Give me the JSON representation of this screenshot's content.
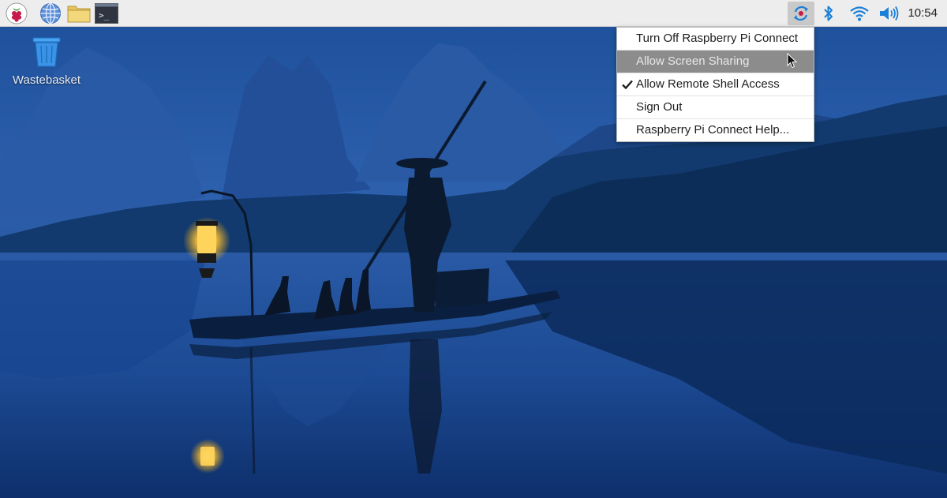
{
  "taskbar": {
    "launchers": [
      {
        "name": "raspberry-menu-icon"
      },
      {
        "name": "web-browser-icon"
      },
      {
        "name": "file-manager-icon"
      },
      {
        "name": "terminal-icon",
        "glyph": ">_"
      }
    ],
    "tray": [
      {
        "name": "raspberry-pi-connect-icon",
        "active": true
      },
      {
        "name": "bluetooth-icon"
      },
      {
        "name": "wifi-icon"
      },
      {
        "name": "volume-icon"
      }
    ],
    "clock": "10:54",
    "accent_color": "#1a7fd6"
  },
  "desktop": {
    "icons": [
      {
        "name": "wastebasket-icon",
        "label": "Wastebasket"
      }
    ]
  },
  "menu": {
    "items": [
      {
        "label": "Turn Off Raspberry Pi Connect",
        "checked": false,
        "highlighted": false
      },
      {
        "label": "Allow Screen Sharing",
        "checked": false,
        "highlighted": true
      },
      {
        "label": "Allow Remote Shell Access",
        "checked": true,
        "highlighted": false
      },
      {
        "label": "Sign Out",
        "checked": false,
        "highlighted": false
      },
      {
        "label": "Raspberry Pi Connect Help...",
        "checked": false,
        "highlighted": false
      }
    ]
  }
}
